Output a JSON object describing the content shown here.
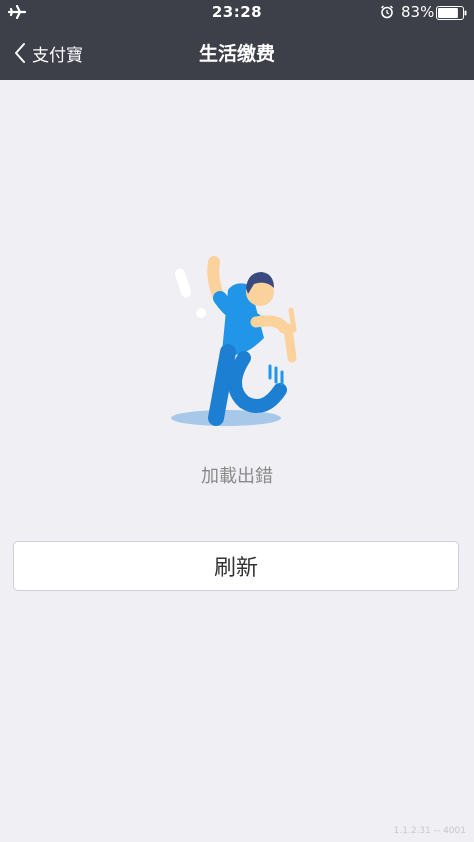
{
  "status_bar": {
    "time": "23:28",
    "battery_percent": "83%",
    "battery_level": 0.83
  },
  "nav": {
    "back_label": "支付寶",
    "title": "生活缴费"
  },
  "main": {
    "error_message": "加載出錯",
    "refresh_label": "刷新"
  },
  "footer": {
    "version": "1.1.2.31 -- 4001"
  },
  "colors": {
    "header_bg": "#3d3f49",
    "page_bg": "#f0eff4",
    "figure_shirt": "#2196e8",
    "figure_skin": "#fbd29b",
    "figure_hair": "#3a4a7e"
  }
}
